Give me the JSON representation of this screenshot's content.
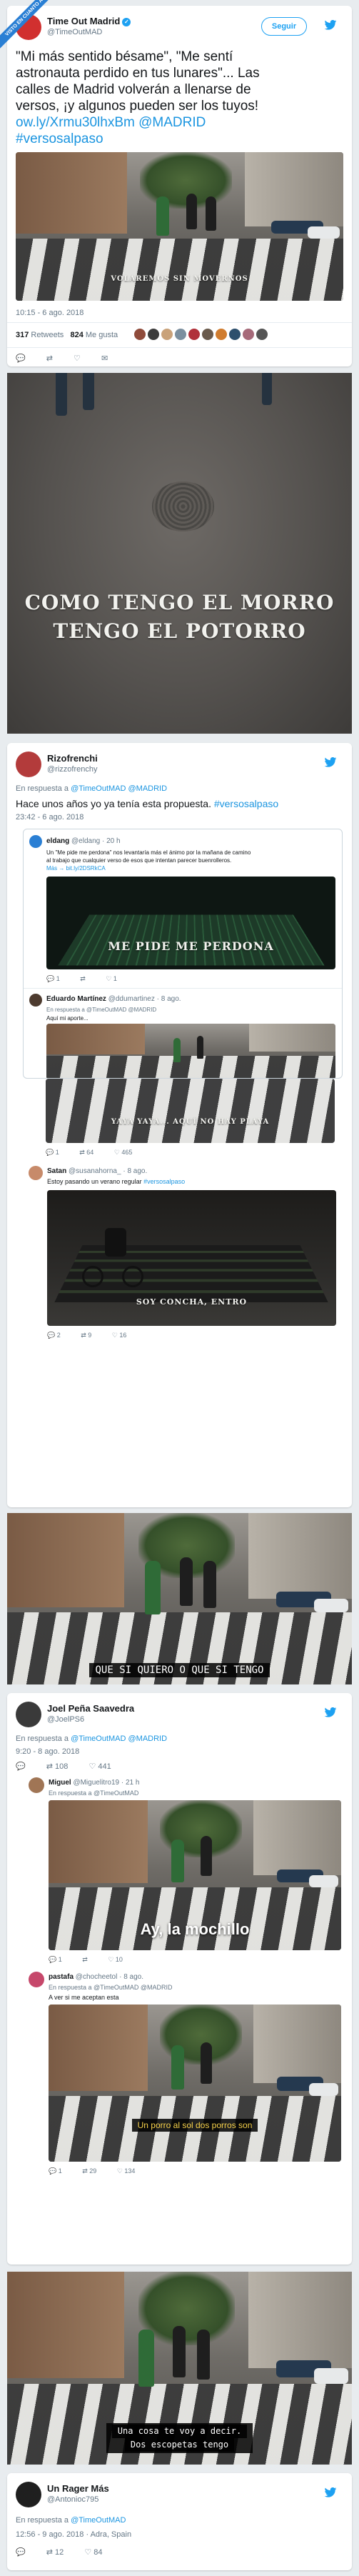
{
  "badge": {
    "label": "VISTO EN CUANTO A"
  },
  "colors": {
    "blue": "#1da1f2",
    "link": "#1b95e0",
    "grey": "#657786",
    "bg": "#e8ecef"
  },
  "main_tweet": {
    "name": "Time Out Madrid",
    "handle": "@TimeOutMAD",
    "follow_label": "Seguir",
    "text_line1": "\"Mi más sentido bésame\", \"Me sentí",
    "text_line2": "astronauta perdido en tus lunares\"... Las",
    "text_line3": "calles de Madrid volverán a llenarse de",
    "text_line4": "versos, ¡y algunos pueden ser los tuyos!",
    "link": "ow.ly/Xrmu30lhxBm",
    "mention": "@MADRID",
    "hashtag": "#versosalpaso",
    "photo1_text": "VOLAREMOS SIN MOVERNOS",
    "photo2_text_line1": "COMO TENGO EL MORRO",
    "photo2_text_line2": "TENGO EL POTORRO",
    "timestamp": "10:15 - 6 ago. 2018",
    "retweets_count": "317",
    "retweets_label": "Retweets",
    "likes_count": "824",
    "likes_label": "Me gusta"
  },
  "rizo_tweet": {
    "name": "Rizofrenchi",
    "handle": "@rizzofrenchy",
    "reply_to_label": "En respuesta a",
    "reply_to_handles": "@TimeOutMAD @MADRID",
    "text": "Hace unos años yo ya tenía esta propuesta.",
    "hashtag": "#versosalpaso",
    "timestamp": "23:42 - 6 ago. 2018",
    "embedded": {
      "name": "eldang",
      "handle": "@eldang · 20 h",
      "text_line1": "Un \"Me pide me perdona\" nos levantaría más el ánimo por la mañana de camino",
      "text_line2": "al trabajo que cualquier verso de esos que intentan parecer buenrolleros.",
      "text_line3": "Más → bit.ly/2DSRkCA",
      "photo_text": "ME PIDE ME PERDONA",
      "replies": "1",
      "likes": "1"
    },
    "reply1": {
      "name": "Eduardo Martínez",
      "handle": "@ddumartinez · 8 ago.",
      "reply_to": "En respuesta a @TimeOutMAD @MADRID",
      "text": "Aquí mi aporte...",
      "photo_text": "YAYA YAYA... AQUÍ NO HAY PLAYA",
      "replies": "1",
      "retweets": "64",
      "likes": "465"
    },
    "reply2": {
      "name": "Satan",
      "handle": "@susanahorna_ · 8 ago.",
      "text_prefix": "Estoy pasando un verano regular",
      "hashtag": "#versosalpaso",
      "photo_text": "SOY CONCHA, ENTRO",
      "replies": "2",
      "retweets": "9",
      "likes": "16"
    }
  },
  "photo_quiero": {
    "text": "QUE SI QUIERO O QUE SI TENGO"
  },
  "joel_tweet": {
    "name": "Joel Peña Saavedra",
    "handle": "@JoelPS6",
    "reply_to_label": "En respuesta a",
    "reply_to_handles": "@TimeOutMAD @MADRID",
    "timestamp": "9:20 - 8 ago. 2018",
    "retweets": "108",
    "likes": "441",
    "reply1": {
      "name": "Miguel",
      "handle": "@Miguelitro19 · 21 h",
      "reply_to": "En respuesta a @TimeOutMAD",
      "photo_text": "Ay, la mochillo",
      "replies": "1",
      "likes": "10"
    },
    "reply2": {
      "name": "pastafa",
      "handle": "@chocheetol · 8 ago.",
      "reply_to": "En respuesta a @TimeOutMAD @MADRID",
      "text": "A ver si me aceptan esta",
      "photo_text": "Un porro al sol dos porros son",
      "replies": "1",
      "retweets": "29",
      "likes": "134"
    }
  },
  "photo_cosa": {
    "text_line1": "Una cosa te voy a decir.",
    "text_line2": "Dos escopetas tengo"
  },
  "rager_tweet": {
    "name": "Un Rager Más",
    "handle": "@Antonioc795",
    "reply_to_label": "En respuesta a",
    "reply_to_handles": "@TimeOutMAD",
    "timestamp": "12:56 - 9 ago. 2018 · Adra, Spain",
    "retweets": "12",
    "likes": "84"
  }
}
